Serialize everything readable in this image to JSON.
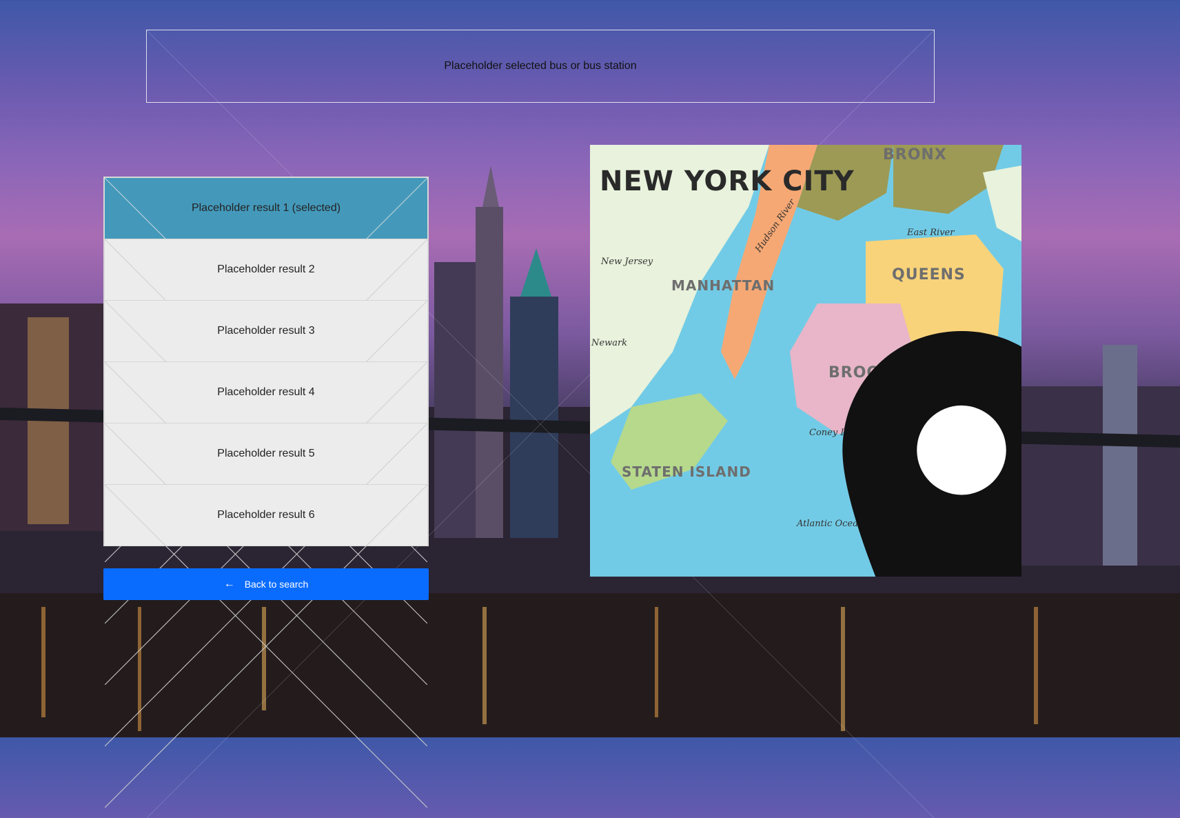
{
  "header": {
    "selected_station": "Placeholder selected bus or bus station"
  },
  "results": [
    {
      "label": "Placeholder result 1 (selected)",
      "selected": true
    },
    {
      "label": "Placeholder result 2",
      "selected": false
    },
    {
      "label": "Placeholder result 3",
      "selected": false
    },
    {
      "label": "Placeholder result 4",
      "selected": false
    },
    {
      "label": "Placeholder result 5",
      "selected": false
    },
    {
      "label": "Placeholder result 6",
      "selected": false
    }
  ],
  "back_button": {
    "label": "Back to search",
    "icon": "arrow-left-icon",
    "color": "#0a6cff"
  },
  "map": {
    "title": "NEW YORK CITY",
    "boroughs": [
      "BRONX",
      "MANHATTAN",
      "QUEENS",
      "BROOKLYN",
      "STATEN ISLAND"
    ],
    "places": [
      "New Jersey",
      "Newark",
      "East River",
      "Atlantic Ocean",
      "Hudson River",
      "Coney Island"
    ],
    "pin_icon": "map-pin-icon"
  },
  "colors": {
    "selected_row": "#4499bb",
    "row": "#ececec"
  }
}
